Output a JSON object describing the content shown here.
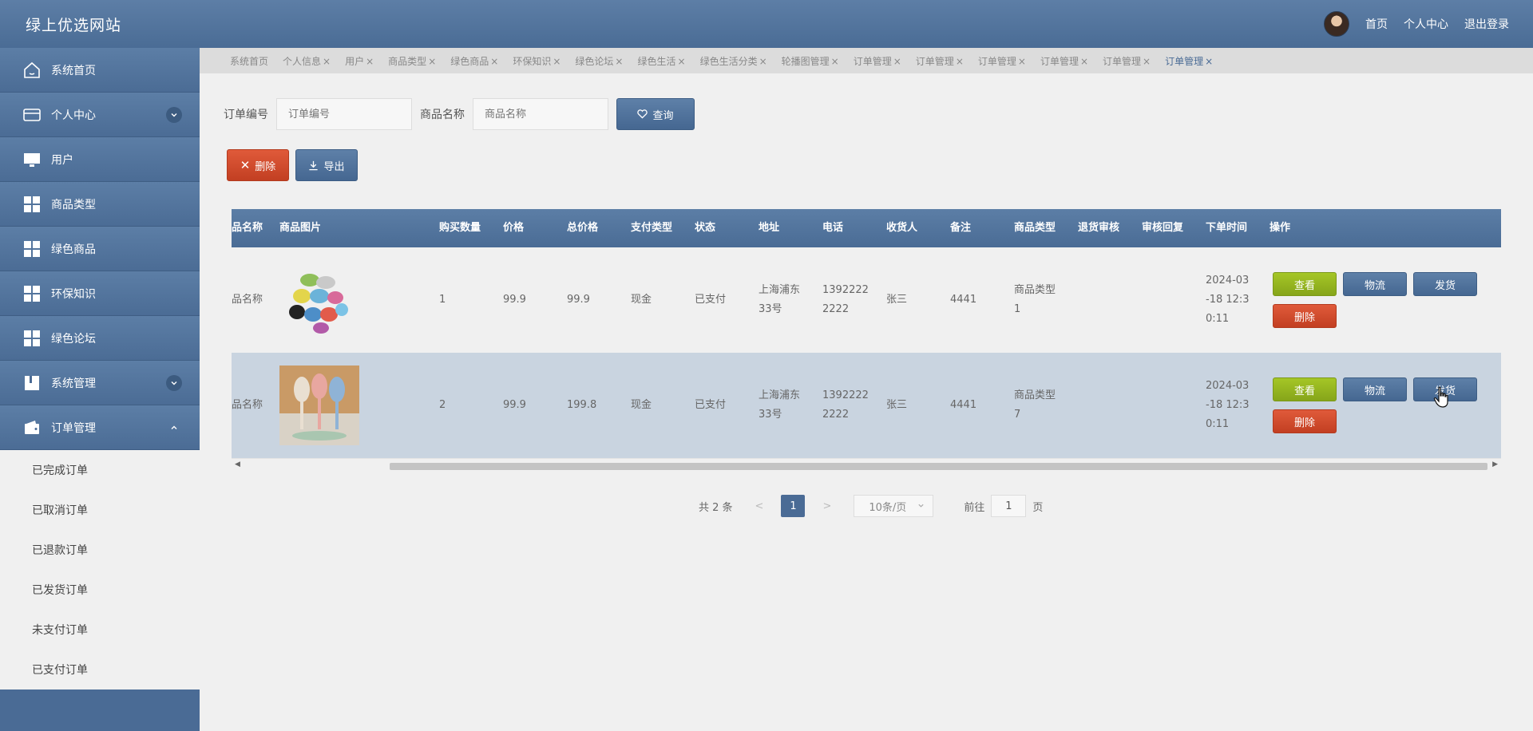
{
  "header": {
    "brand": "绿上优选网站",
    "links": [
      "首页",
      "个人中心",
      "退出登录"
    ]
  },
  "sidebar": {
    "items": [
      {
        "label": "系统首页",
        "icon": "home-icon"
      },
      {
        "label": "个人中心",
        "icon": "card-icon",
        "chevron": "down"
      },
      {
        "label": "用户",
        "icon": "monitor-icon"
      },
      {
        "label": "商品类型",
        "icon": "grid-icon"
      },
      {
        "label": "绿色商品",
        "icon": "grid-icon"
      },
      {
        "label": "环保知识",
        "icon": "grid-icon"
      },
      {
        "label": "绿色论坛",
        "icon": "grid-icon"
      },
      {
        "label": "系统管理",
        "icon": "book-icon",
        "chevron": "down"
      },
      {
        "label": "订单管理",
        "icon": "wallet-icon",
        "chevron": "up"
      }
    ],
    "sub_items": [
      "已完成订单",
      "已取消订单",
      "已退款订单",
      "已发货订单",
      "未支付订单",
      "已支付订单"
    ]
  },
  "tabs": [
    "系统首页",
    "个人信息",
    "用户",
    "商品类型",
    "绿色商品",
    "环保知识",
    "绿色论坛",
    "绿色生活",
    "绿色生活分类",
    "轮播图管理",
    "订单管理",
    "订单管理",
    "订单管理",
    "订单管理",
    "订单管理",
    "订单管理"
  ],
  "search": {
    "order_no_label": "订单编号",
    "order_no_placeholder": "订单编号",
    "product_label": "商品名称",
    "product_placeholder": "商品名称",
    "query_label": "查询"
  },
  "actions": {
    "delete_label": "删除",
    "export_label": "导出"
  },
  "table": {
    "columns": [
      "品名称",
      "商品图片",
      "购买数量",
      "价格",
      "总价格",
      "支付类型",
      "状态",
      "地址",
      "电话",
      "收货人",
      "备注",
      "商品类型",
      "退货审核",
      "审核回复",
      "下单时间",
      "操作"
    ],
    "rows": [
      {
        "name": "品名称",
        "qty": "1",
        "price": "99.9",
        "total": "99.9",
        "pay": "现金",
        "status": "已支付",
        "addr1": "上海浦东",
        "addr2": "33号",
        "phone1": "1392222",
        "phone2": "2222",
        "receiver": "张三",
        "note": "4441",
        "type1": "商品类型",
        "type2": "1",
        "time1": "2024-03",
        "time2": "-18 12:3",
        "time3": "0:11",
        "image": "colorful-trash-bags"
      },
      {
        "name": "品名称",
        "qty": "2",
        "price": "99.9",
        "total": "199.8",
        "pay": "现金",
        "status": "已支付",
        "addr1": "上海浦东",
        "addr2": "33号",
        "phone1": "1392222",
        "phone2": "2222",
        "receiver": "张三",
        "note": "4441",
        "type1": "商品类型",
        "type2": "7",
        "time1": "2024-03",
        "time2": "-18 12:3",
        "time3": "0:11",
        "image": "leaf-spoons"
      }
    ],
    "ops": {
      "view": "查看",
      "logistics": "物流",
      "ship": "发货",
      "delete": "删除"
    }
  },
  "pager": {
    "total": "共 2 条",
    "prev": "<",
    "current": "1",
    "next": ">",
    "page_size": "10条/页",
    "goto_prefix": "前往",
    "goto_value": "1",
    "goto_suffix": "页"
  },
  "colors": {
    "primary": "#4a6b95",
    "success": "#97b821",
    "danger": "#d24b2d"
  }
}
